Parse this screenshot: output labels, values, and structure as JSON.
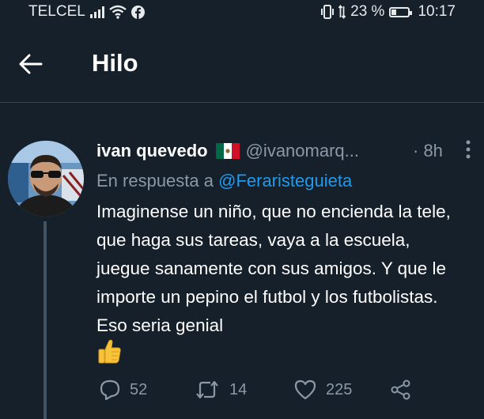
{
  "status_bar": {
    "carrier": "TELCEL",
    "battery_percent": "23 %",
    "battery_level": 0.23,
    "time": "10:17"
  },
  "header": {
    "title": "Hilo"
  },
  "tweet": {
    "author_name": "ivan quevedo",
    "flag": "mexico-flag",
    "handle": "@ivanomarq...",
    "time": "· 8h",
    "reply_prefix": "En respuesta a",
    "reply_to": "@Feraristeguieta",
    "text": "Imaginense un niño, que no encienda la tele, que haga sus tareas, vaya a la escuela, juegue sanamente con sus amigos. Y que le importe un pepino el futbol y los futbolistas. Eso seria genial",
    "emoji": "👍",
    "reply_count": "52",
    "retweet_count": "14",
    "like_count": "225"
  },
  "colors": {
    "background": "#15202b",
    "secondary_text": "#8b98a5",
    "link": "#1d9bf0",
    "divider": "#38444d"
  }
}
